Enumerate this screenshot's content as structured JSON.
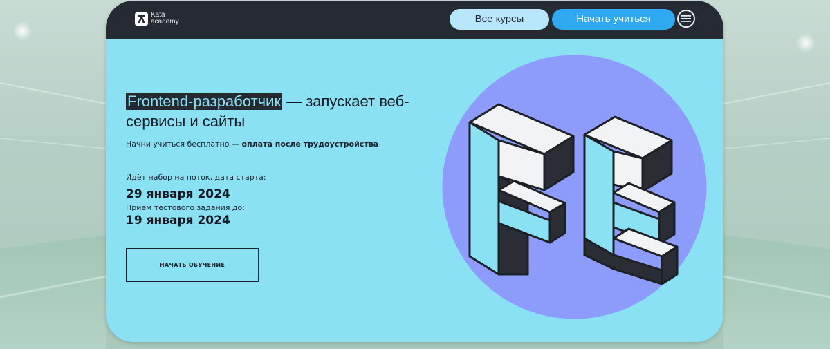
{
  "brand": {
    "name_line1": "Kata",
    "name_line2": "academy",
    "logo_icon": "kata-logo-icon"
  },
  "nav": {
    "courses_label": "Все курсы",
    "start_label": "Начать учиться",
    "menu_icon": "menu-icon"
  },
  "hero": {
    "headline_highlight": "Frontend-разработчик",
    "headline_rest": " — запускает веб-сервисы и сайты",
    "subtitle_plain": "Начни учиться бесплатно — ",
    "subtitle_bold": "оплата после трудоустройства",
    "recruit_label": "Идёт набор на поток, дата старта:",
    "start_date": "29 января 2024",
    "test_label": "Приём тестового задания до:",
    "test_date": "19 января 2024",
    "cta_label": "НАЧАТЬ ОБУЧЕНИЕ",
    "art_icon": "fe-letters-illustration"
  },
  "colors": {
    "card_bg": "#8ae1f4",
    "topbar_bg": "#262b33",
    "courses_btn": "#b8e6fb",
    "start_btn": "#2fa9f2",
    "circle": "#8d9cfa",
    "letter_dark": "#2a2d33",
    "letter_light": "#f1f3f4"
  }
}
